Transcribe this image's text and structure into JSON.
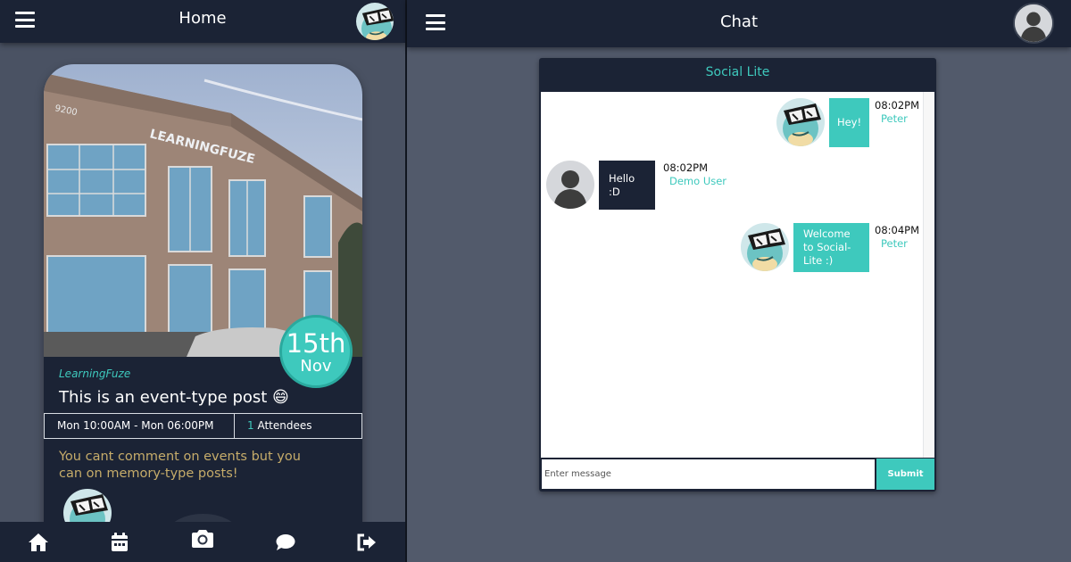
{
  "left_pane": {
    "header": {
      "title": "Home",
      "menu_icon": "hamburger-menu-icon",
      "avatar_icon": "squirtle-avatar"
    },
    "event_card": {
      "photo_sign_number": "9200",
      "photo_sign_text": "LEARNINGFUZE",
      "date_day": "15th",
      "date_month": "Nov",
      "author": "LearningFuze",
      "title": "This is an event-type post 😄",
      "time_range": "Mon 10:00AM - Mon 06:00PM",
      "attendee_count": "1",
      "attendee_label": "Attendees",
      "note": "You cant comment on events but you can on memory-type posts!"
    },
    "bottom_nav": {
      "items": [
        "home-icon",
        "calendar-icon",
        "camera-icon",
        "chat-bubble-icon",
        "logout-icon"
      ],
      "active": "camera-icon"
    }
  },
  "right_pane": {
    "header": {
      "title": "Chat",
      "menu_icon": "hamburger-menu-icon",
      "avatar_icon": "default-user-avatar"
    },
    "chat": {
      "room_title": "Social Lite",
      "messages": [
        {
          "text": "Hey!",
          "time": "08:02PM",
          "sender": "Peter",
          "own": true
        },
        {
          "text": "Hello :D",
          "time": "08:02PM",
          "sender": "Demo User",
          "own": false
        },
        {
          "text": "Welcome to Social-Lite :)",
          "time": "08:04PM",
          "sender": "Peter",
          "own": true
        }
      ],
      "input_placeholder": "Enter message",
      "submit_label": "Submit"
    }
  },
  "colors": {
    "navy": "#1b2335",
    "teal": "#3ec9bd",
    "background": "#525a6b",
    "note_gold": "#c6ac6a"
  }
}
